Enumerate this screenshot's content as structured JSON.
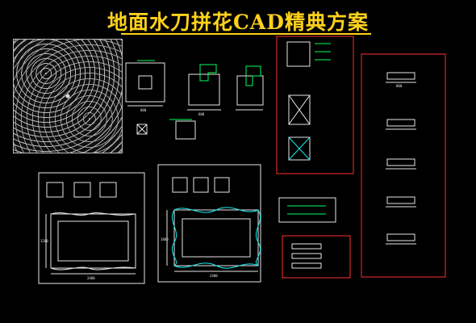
{
  "title": "地面水刀拼花CAD精典方案",
  "dims": {
    "left_width": "2400",
    "left_height": "1200",
    "middle_width": "2400",
    "middle_height": "1800",
    "detail_w": "800",
    "detail_w2": "600",
    "detail_h": "800",
    "right_w": "800",
    "right_h": "200"
  },
  "colors": {
    "title": "#ffd21a",
    "frame": "#ff3030",
    "line": "#e6e6e6",
    "accent": "#00ff60",
    "ornament": "#1ee"
  }
}
